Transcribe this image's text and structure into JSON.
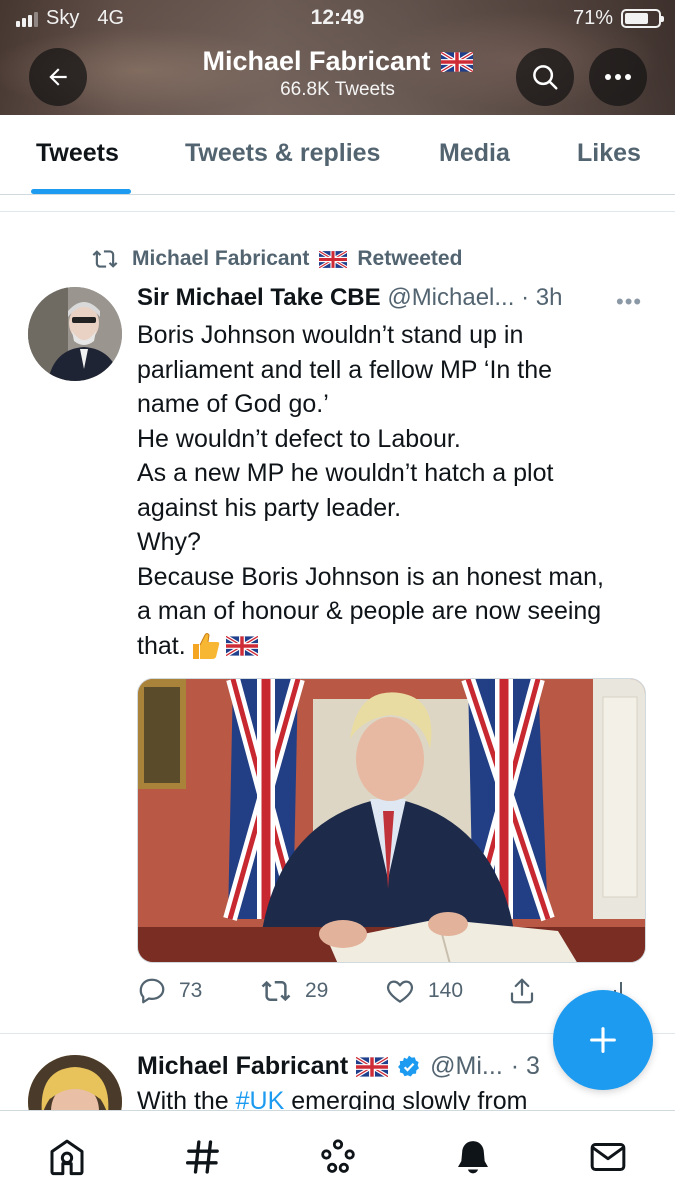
{
  "status_bar": {
    "carrier": "Sky",
    "network": "4G",
    "time": "12:49",
    "battery": "71%",
    "battery_level": 0.71
  },
  "header": {
    "name": "Michael Fabricant",
    "flag_icon": "uk-flag-icon",
    "tweet_count": "66.8K Tweets",
    "back_icon": "back-arrow-icon",
    "search_icon": "search-icon",
    "more_icon": "more-horizontal-icon"
  },
  "tabs": [
    {
      "label": "Tweets",
      "active": true
    },
    {
      "label": "Tweets & replies",
      "active": false
    },
    {
      "label": "Media",
      "active": false
    },
    {
      "label": "Likes",
      "active": false
    }
  ],
  "tweet1": {
    "retweeted_by": "Michael Fabricant",
    "retweeted_label": "Retweeted",
    "author_name": "Sir Michael Take CBE",
    "handle": "@Michael...",
    "time": "· 3h",
    "text_lines": [
      "Boris Johnson wouldn’t stand up in",
      "parliament and tell a fellow MP ‘In the",
      "name of God go.’",
      "He wouldn’t defect to Labour.",
      "As a new MP he wouldn’t hatch a plot",
      "against his party leader.",
      "Why?",
      "Because Boris Johnson is an honest man,",
      "a man of honour & people are now seeing",
      "that."
    ],
    "replies": "73",
    "retweets": "29",
    "likes": "140"
  },
  "tweet2": {
    "author_name": "Michael Fabricant",
    "handle": "@Mi...",
    "time": "· 3",
    "text_prefix": "With the ",
    "hashtag": "#UK",
    "text_suffix": " emerging slowly from"
  },
  "colors": {
    "accent": "#1d9bf0",
    "secondary_text": "#536471",
    "primary_text": "#0f1419",
    "border": "#cfd9de"
  },
  "bottom_nav": [
    {
      "icon": "home-icon"
    },
    {
      "icon": "hashtag-explore-icon"
    },
    {
      "icon": "spaces-icon"
    },
    {
      "icon": "notifications-bell-icon"
    },
    {
      "icon": "messages-envelope-icon"
    }
  ]
}
